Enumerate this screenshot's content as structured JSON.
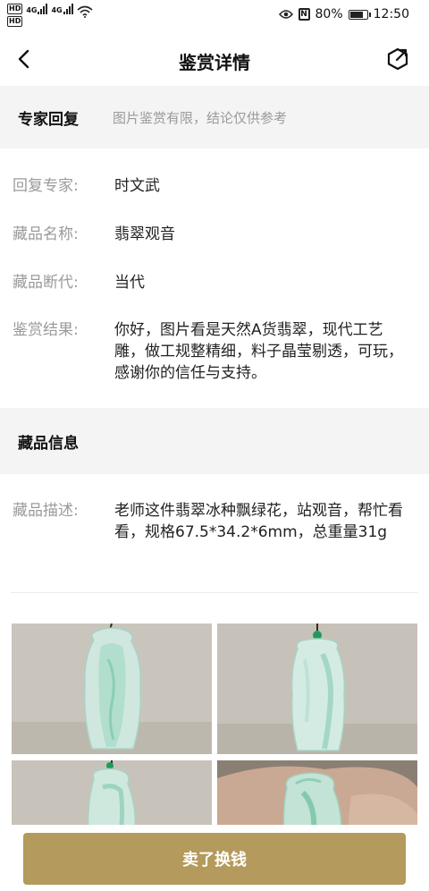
{
  "status_bar": {
    "hd1": "HD",
    "hd2": "HD",
    "net1": "4G",
    "net2": "4G",
    "battery": "80%",
    "time": "12:50",
    "icons": [
      "eye-comfort-icon",
      "nfc-icon",
      "battery-icon",
      "wifi-icon",
      "signal-icon"
    ]
  },
  "nav": {
    "title": "鉴赏详情",
    "back_icon": "chevron-left-icon",
    "share_icon": "share-icon"
  },
  "expert": {
    "header_title": "专家回复",
    "header_note": "图片鉴赏有限，结论仅供参考",
    "rows": [
      {
        "label": "回复专家:",
        "value": "时文武"
      },
      {
        "label": "藏品名称:",
        "value": "翡翠观音"
      },
      {
        "label": "藏品断代:",
        "value": "当代"
      },
      {
        "label": "鉴赏结果:",
        "value": "你好，图片看是天然A货翡翠，现代工艺雕，做工规整精细，料子晶莹剔透，可玩，感谢你的信任与支持。"
      }
    ]
  },
  "collection": {
    "header_title": "藏品信息",
    "desc_label": "藏品描述:",
    "desc_value": "老师这件翡翠冰种飘绿花，站观音，帮忙看看，规格67.5*34.2*6mm，总重量31g"
  },
  "photos": [
    "jade-photo-front",
    "jade-photo-side",
    "jade-photo-bottom-left",
    "jade-photo-in-hand"
  ],
  "action": {
    "sell_label": "卖了换钱"
  },
  "colors": {
    "accent": "#b49a5c",
    "section_bg": "#f4f4f4",
    "label": "#9a9a9a"
  }
}
